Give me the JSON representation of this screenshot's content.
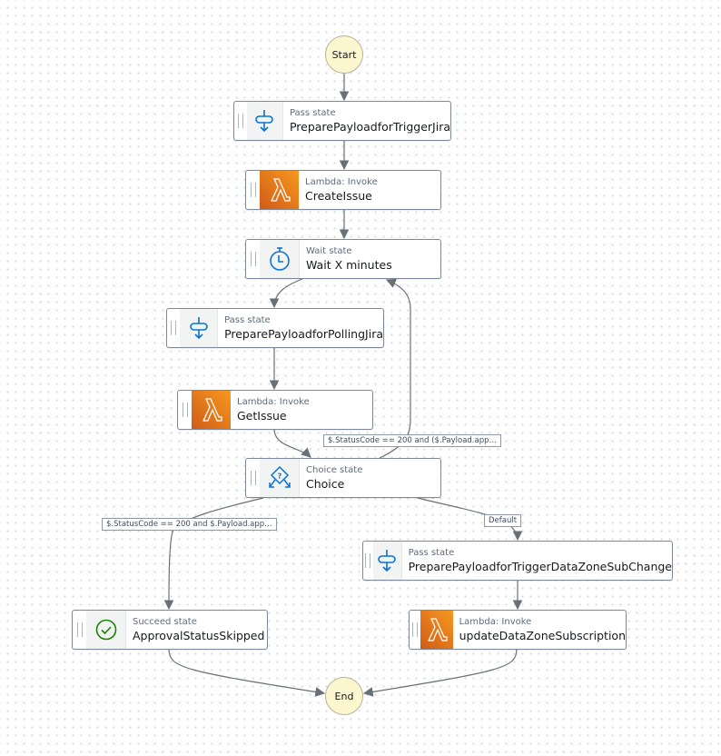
{
  "colors": {
    "edge": "#687078",
    "lambda_gradient_start": "#f7981f",
    "lambda_gradient_end": "#d05c17",
    "pass_icon": "#0972d3",
    "succeed_icon": "#1d8102",
    "terminal_fill": "#fdf7cf"
  },
  "start": {
    "label": "Start"
  },
  "end": {
    "label": "End"
  },
  "states": [
    {
      "id": "trigger-jira",
      "kind": "Pass state",
      "name": "PreparePayloadforTriggerJira",
      "icon": "pass-icon"
    },
    {
      "id": "create-issue",
      "kind": "Lambda: Invoke",
      "name": "CreateIssue",
      "icon": "lambda-icon"
    },
    {
      "id": "wait",
      "kind": "Wait state",
      "name": "Wait X minutes",
      "icon": "timer-icon"
    },
    {
      "id": "polling-jira",
      "kind": "Pass state",
      "name": "PreparePayloadforPollingJira",
      "icon": "pass-icon"
    },
    {
      "id": "get-issue",
      "kind": "Lambda: Invoke",
      "name": "GetIssue",
      "icon": "lambda-icon"
    },
    {
      "id": "choice",
      "kind": "Choice state",
      "name": "Choice",
      "icon": "choice-icon"
    },
    {
      "id": "trigger-datazone",
      "kind": "Pass state",
      "name": "PreparePayloadforTriggerDataZoneSubChange",
      "icon": "pass-icon"
    },
    {
      "id": "approval-skipped",
      "kind": "Succeed state",
      "name": "ApprovalStatusSkipped",
      "icon": "check-circle-icon"
    },
    {
      "id": "update-datazone",
      "kind": "Lambda: Invoke",
      "name": "updateDataZoneSubscription",
      "icon": "lambda-icon"
    }
  ],
  "edge_labels": {
    "loop_back": "$.StatusCode == 200 and ($.Payload.app…",
    "skipped": "$.StatusCode == 200 and $.Payload.app…",
    "default": "Default"
  },
  "edges": [
    {
      "from": "start",
      "to": "trigger-jira"
    },
    {
      "from": "trigger-jira",
      "to": "create-issue"
    },
    {
      "from": "create-issue",
      "to": "wait"
    },
    {
      "from": "wait",
      "to": "polling-jira"
    },
    {
      "from": "polling-jira",
      "to": "get-issue"
    },
    {
      "from": "get-issue",
      "to": "choice"
    },
    {
      "from": "choice",
      "to": "wait",
      "label": "loop_back"
    },
    {
      "from": "choice",
      "to": "approval-skipped",
      "label": "skipped"
    },
    {
      "from": "choice",
      "to": "trigger-datazone",
      "label": "default"
    },
    {
      "from": "trigger-datazone",
      "to": "update-datazone"
    },
    {
      "from": "approval-skipped",
      "to": "end"
    },
    {
      "from": "update-datazone",
      "to": "end"
    }
  ]
}
